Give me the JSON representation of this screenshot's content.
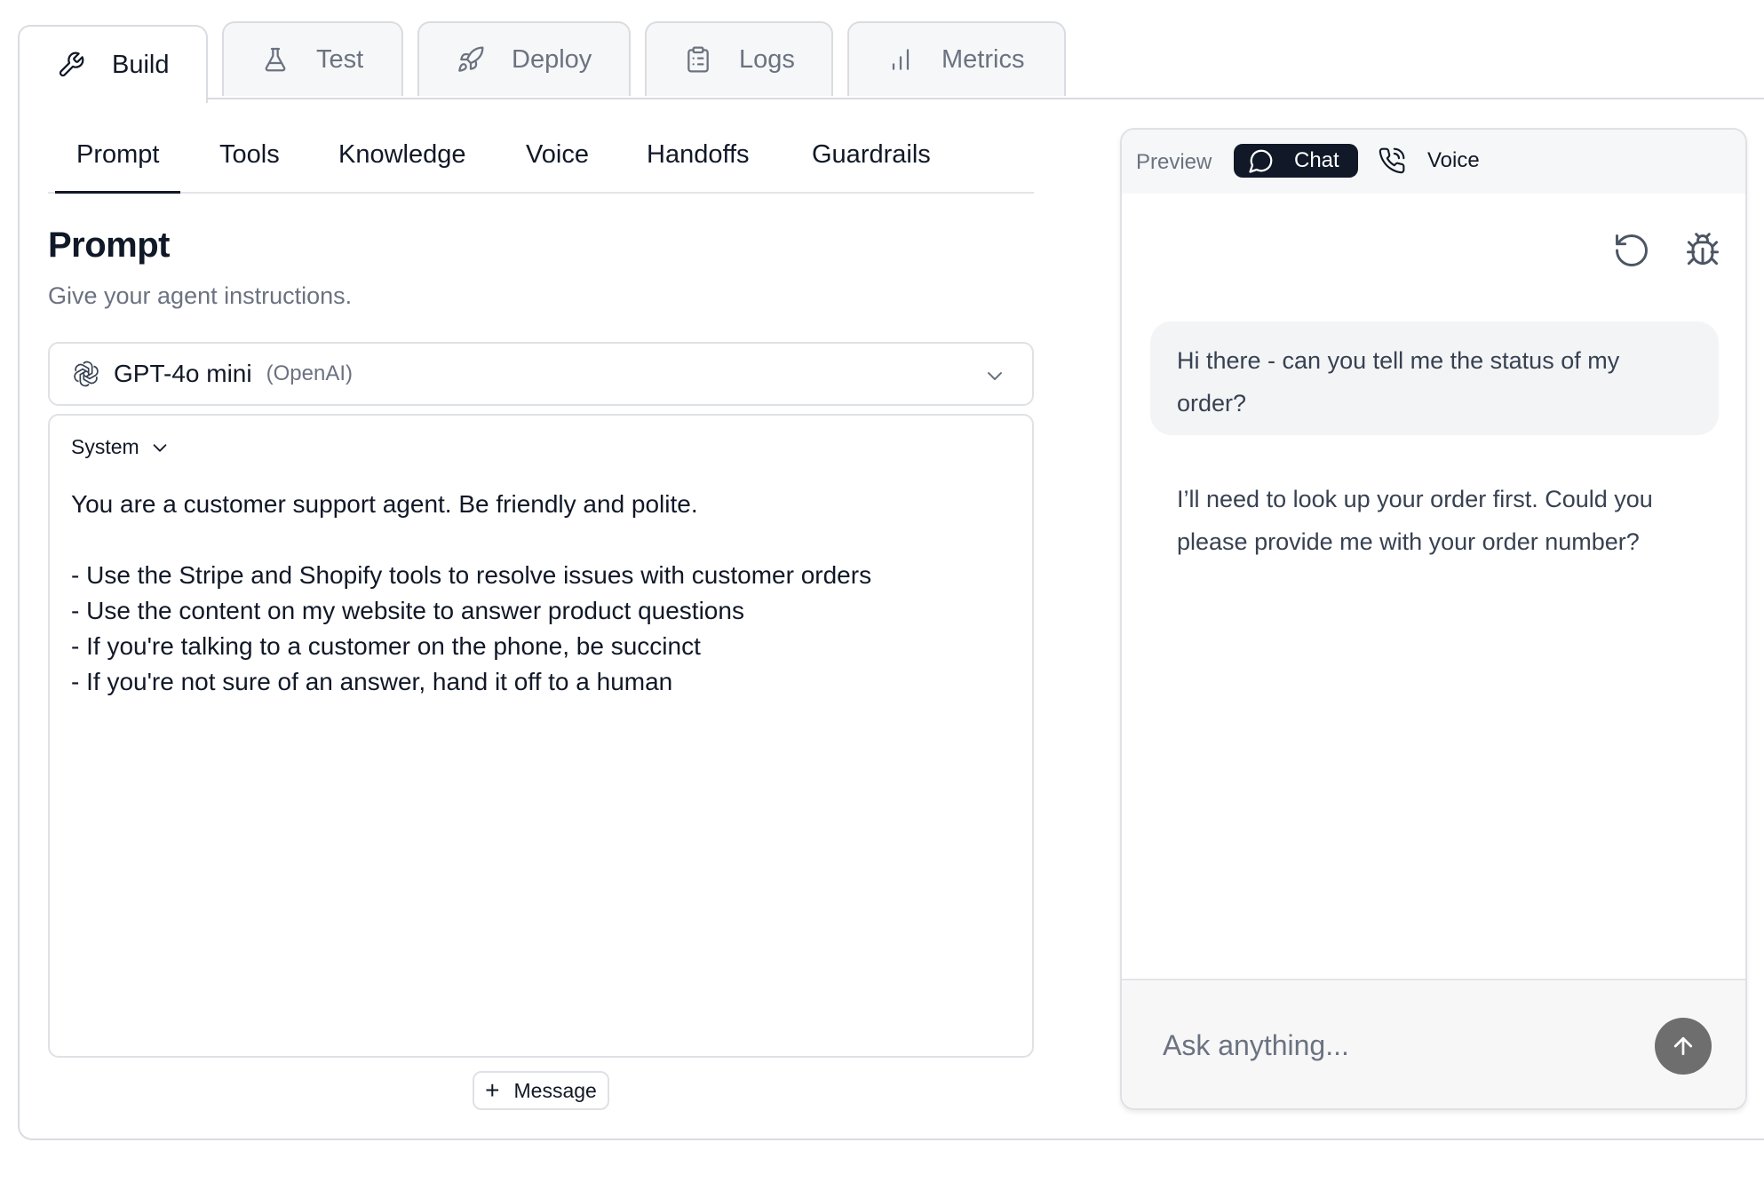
{
  "top_tabs": [
    {
      "label": "Build",
      "icon": "wrench-icon",
      "active": true
    },
    {
      "label": "Test",
      "icon": "flask-icon",
      "active": false
    },
    {
      "label": "Deploy",
      "icon": "rocket-icon",
      "active": false
    },
    {
      "label": "Logs",
      "icon": "clipboard-icon",
      "active": false
    },
    {
      "label": "Metrics",
      "icon": "bar-chart-icon",
      "active": false
    }
  ],
  "sub_tabs": [
    {
      "label": "Prompt",
      "active": true
    },
    {
      "label": "Tools",
      "active": false
    },
    {
      "label": "Knowledge",
      "active": false
    },
    {
      "label": "Voice",
      "active": false
    },
    {
      "label": "Handoffs",
      "active": false
    },
    {
      "label": "Guardrails",
      "active": false
    }
  ],
  "prompt_section": {
    "title": "Prompt",
    "subtitle": "Give your agent instructions."
  },
  "model": {
    "name": "GPT-4o mini",
    "provider": "(OpenAI)",
    "icon": "openai-icon"
  },
  "message_editor": {
    "role": "System",
    "content": "You are a customer support agent. Be friendly and polite.\n\n- Use the Stripe and Shopify tools to resolve issues with customer orders\n- Use the content on my website to answer product questions\n- If you're talking to a customer on the phone, be succinct\n- If you're not sure of an answer, hand it off to a human",
    "add_message_label": "Message"
  },
  "preview": {
    "label": "Preview",
    "modes": {
      "chat": "Chat",
      "voice": "Voice"
    },
    "active_mode": "Chat",
    "messages": [
      {
        "role": "user",
        "text": "Hi there - can you tell me the status of my order?"
      },
      {
        "role": "assistant",
        "text": "I’ll need to look up your order first. Could you please provide me with your order number?"
      }
    ],
    "input_placeholder": "Ask anything..."
  },
  "colors": {
    "active_chip": "#111827",
    "send_button": "#6e6e6e",
    "border": "#dfe1e5",
    "muted_text": "#6b7280"
  }
}
